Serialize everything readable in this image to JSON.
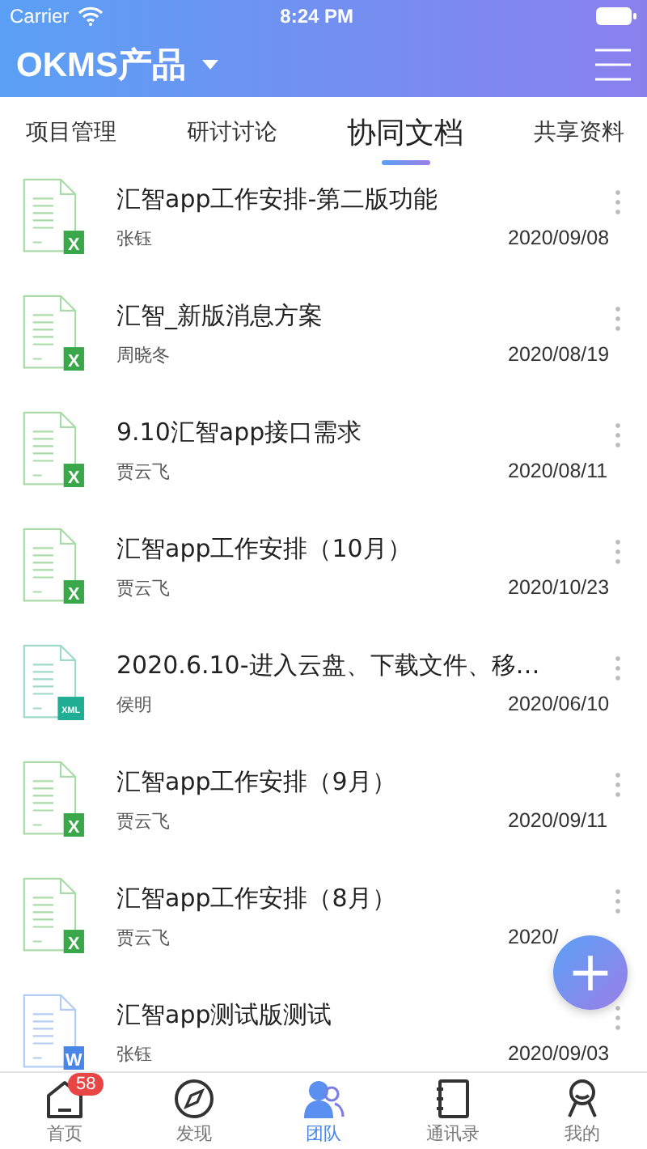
{
  "status_bar": {
    "carrier": "Carrier",
    "time": "8:24 PM"
  },
  "header": {
    "title": "OKMS产品"
  },
  "tabs": [
    {
      "label": "项目管理",
      "selected": false
    },
    {
      "label": "研讨讨论",
      "selected": false
    },
    {
      "label": "协同文档",
      "selected": true
    },
    {
      "label": "共享资料",
      "selected": false
    }
  ],
  "files": [
    {
      "kind": "excel",
      "badge": "X",
      "title": "汇智app工作安排-第二版功能",
      "author": "张钰",
      "date": "2020/09/08"
    },
    {
      "kind": "excel",
      "badge": "X",
      "title": "汇智_新版消息方案",
      "author": "周晓冬",
      "date": "2020/08/19"
    },
    {
      "kind": "excel",
      "badge": "X",
      "title": "9.10汇智app接口需求",
      "author": "贾云飞",
      "date": "2020/08/11"
    },
    {
      "kind": "excel",
      "badge": "X",
      "title": "汇智app工作安排（10月）",
      "author": "贾云飞",
      "date": "2020/10/23"
    },
    {
      "kind": "xml",
      "badge": "XML",
      "title": "2020.6.10-进入云盘、下载文件、移…",
      "author": "侯明",
      "date": "2020/06/10"
    },
    {
      "kind": "excel",
      "badge": "X",
      "title": "汇智app工作安排（9月）",
      "author": "贾云飞",
      "date": "2020/09/11"
    },
    {
      "kind": "excel",
      "badge": "X",
      "title": "汇智app工作安排（8月）",
      "author": "贾云飞",
      "date": "2020/"
    },
    {
      "kind": "word",
      "badge": "W",
      "title": "汇智app测试版测试",
      "author": "张钰",
      "date": "2020/09/03"
    }
  ],
  "fab": {
    "label": "+"
  },
  "tabbar": [
    {
      "kind": "home",
      "label": "首页",
      "badge": "58",
      "selected": false
    },
    {
      "kind": "discover",
      "label": "发现",
      "selected": false
    },
    {
      "kind": "team",
      "label": "团队",
      "selected": true
    },
    {
      "kind": "contacts",
      "label": "通讯录",
      "selected": false
    },
    {
      "kind": "me",
      "label": "我的",
      "selected": false
    }
  ]
}
